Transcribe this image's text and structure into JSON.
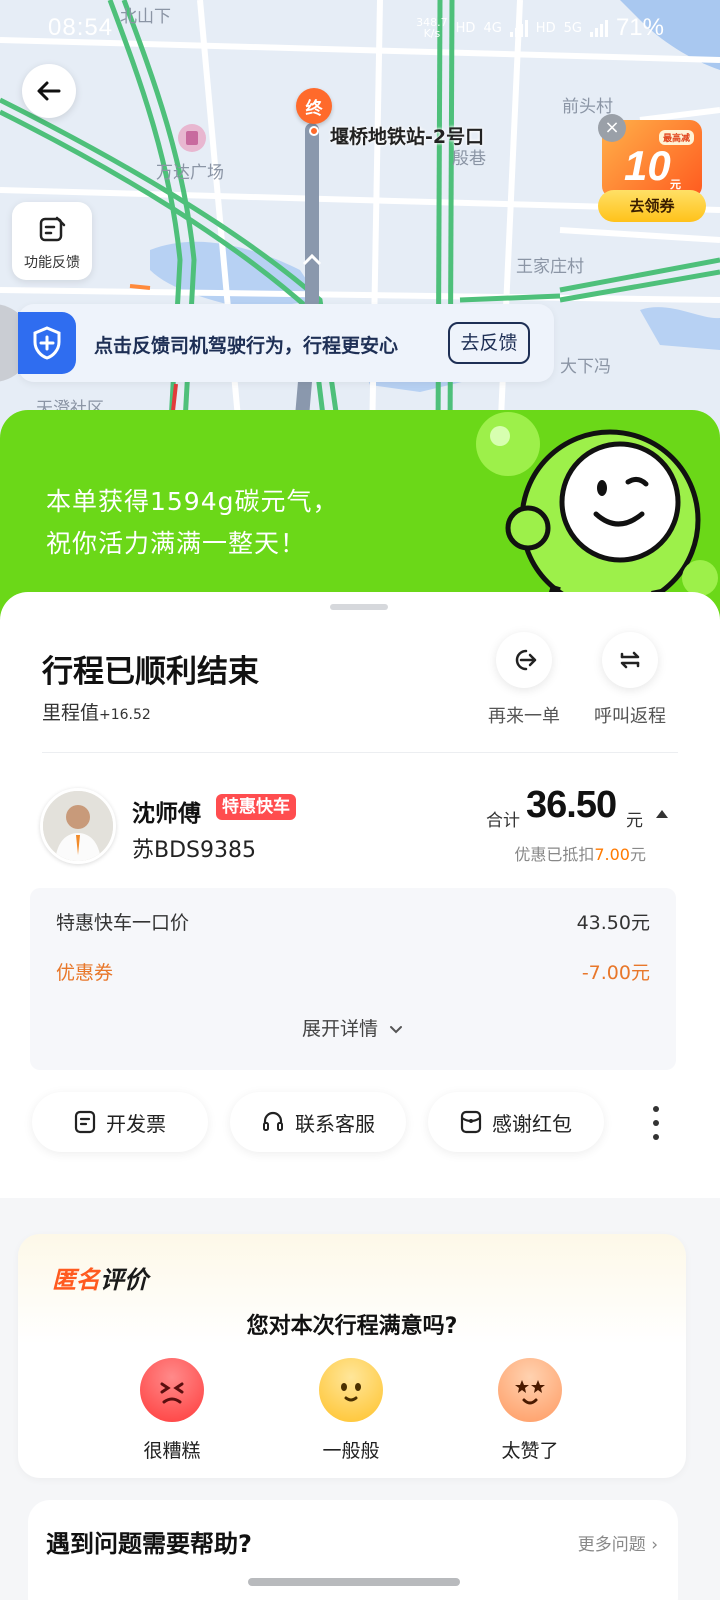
{
  "status_bar": {
    "time": "08:54",
    "net_speed": "348.7",
    "net_unit": "K/s",
    "hd": "HD",
    "net_4g": "4G",
    "net_5g": "5G",
    "battery": "71%"
  },
  "map": {
    "labels": [
      "北山下",
      "万达广场",
      "前头村",
      "殷巷",
      "王家庄村",
      "大下冯",
      "天澄社区"
    ],
    "destination_marker": "终",
    "destination_name": "堰桥地铁站-2号口",
    "feedback_button_label": "功能反馈",
    "coupon": {
      "tag": "最高减",
      "amount": "10",
      "unit": "元",
      "button": "去领券"
    },
    "safety_banner": {
      "text": "点击反馈司机驾驶行为，行程更安心",
      "button": "去反馈"
    }
  },
  "banner": {
    "line1": "本单获得1594g碳元气，",
    "line2": "祝你活力满满一整天！"
  },
  "trip": {
    "title": "行程已顺利结束",
    "mileage_label": "里程值",
    "mileage_value": "+16.52",
    "actions": [
      {
        "label": "再来一单",
        "icon": "reorder-icon"
      },
      {
        "label": "呼叫返程",
        "icon": "return-trip-icon"
      }
    ]
  },
  "driver": {
    "name": "沈师傅",
    "car_type": "特惠快车",
    "plate": "苏BDS9385"
  },
  "fare": {
    "total_label": "合计",
    "total": "36.50",
    "unit": "元",
    "discount_prefix": "优惠已抵扣",
    "discount_value": "7.00",
    "discount_suffix": "元",
    "rows": [
      {
        "label": "特惠快车一口价",
        "value": "43.50元"
      },
      {
        "label": "优惠券",
        "value": "-7.00元"
      }
    ],
    "expand_label": "展开详情"
  },
  "quick_actions": [
    {
      "label": "开发票",
      "icon": "invoice-icon"
    },
    {
      "label": "联系客服",
      "icon": "headset-icon"
    },
    {
      "label": "感谢红包",
      "icon": "red-envelope-icon"
    }
  ],
  "rating": {
    "tag_part1": "匿名",
    "tag_part2": "评价",
    "question": "您对本次行程满意吗?",
    "options": [
      {
        "label": "很糟糕",
        "color": "#ff4b4b"
      },
      {
        "label": "一般般",
        "color": "#ffc93a"
      },
      {
        "label": "太赞了",
        "color": "#ffa06a"
      }
    ]
  },
  "help": {
    "title": "遇到问题需要帮助?",
    "more": "更多问题 ›"
  },
  "colors": {
    "brand_green": "#6bd818",
    "accent_orange": "#ff7a00",
    "tag_red": "#ff4d4f",
    "safety_blue": "#2f6df0"
  }
}
